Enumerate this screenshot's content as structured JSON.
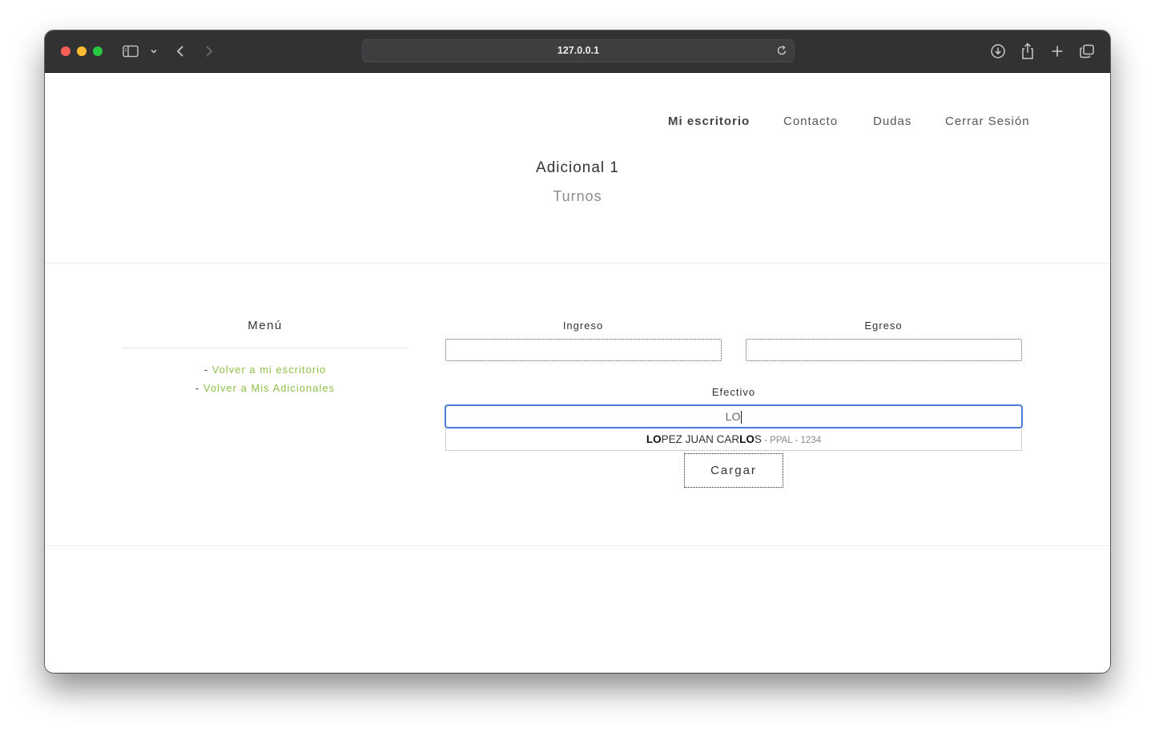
{
  "browser": {
    "address": "127.0.0.1"
  },
  "nav": {
    "items": [
      "Mi escritorio",
      "Contacto",
      "Dudas",
      "Cerrar Sesión"
    ]
  },
  "header": {
    "title": "Adicional 1",
    "subtitle": "Turnos"
  },
  "menu": {
    "title": "Menú",
    "prefix": "- ",
    "links": [
      "Volver a mi escritorio",
      "Volver a Mis Adicionales"
    ]
  },
  "form": {
    "ingreso_label": "Ingreso",
    "egreso_label": "Egreso",
    "efectivo_label": "Efectivo",
    "ingreso_value": "",
    "egreso_value": "",
    "efectivo_value": "LO",
    "suggestion": {
      "m1": "LO",
      "p1": "PEZ JUAN CAR",
      "m2": "LO",
      "p2": "S",
      "meta": " - PPAL - 1234"
    },
    "submit_label": "Cargar"
  },
  "colors": {
    "link": "#8fc04a",
    "focus": "#4a7ddb",
    "titlebar": "#323233"
  }
}
